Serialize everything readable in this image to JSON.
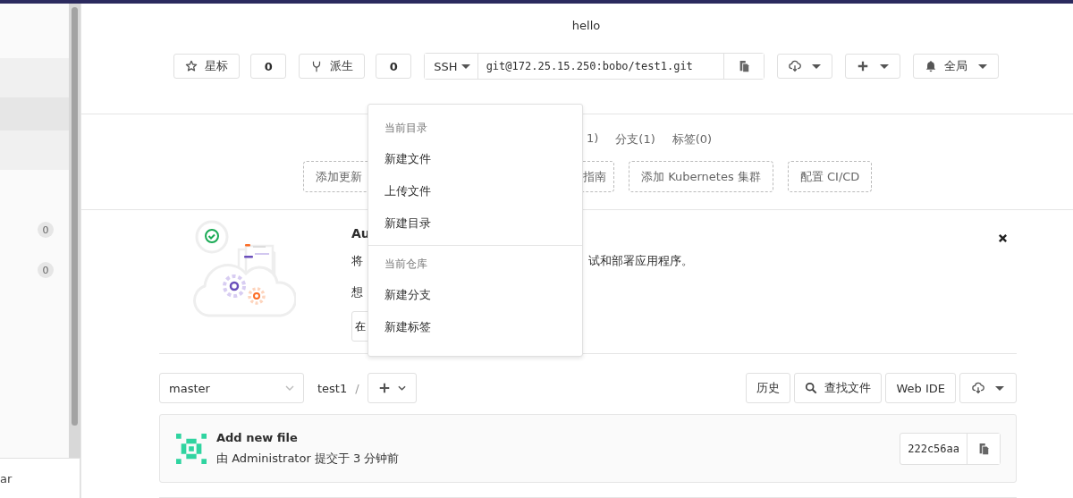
{
  "sidebar": {
    "items": [
      {
        "selected": false
      },
      {
        "selected": true
      },
      {
        "selected": false
      }
    ],
    "badges": [
      "0",
      "0"
    ],
    "footer": "ar"
  },
  "project_title": "hello",
  "actions": {
    "star": {
      "label": "星标",
      "count": "0"
    },
    "fork": {
      "label": "派生",
      "count": "0"
    },
    "clone": {
      "protocol": "SSH",
      "url": "git@172.25.15.250:bobo/test1.git"
    },
    "notification": {
      "label": "全局"
    }
  },
  "stats": [
    "1)",
    "分支(1)",
    "标签(0)"
  ],
  "quick_buttons": [
    "添加更新",
    "指南",
    "添加 Kubernetes 集群",
    "配置 CI/CD"
  ],
  "banner": {
    "title": "Au",
    "text_start": "将",
    "text_end": "试和部署应用程序。",
    "line2": "想",
    "button": "在"
  },
  "dropdown": {
    "sections": [
      {
        "header": "当前目录",
        "items": [
          "新建文件",
          "上传文件",
          "新建目录"
        ]
      },
      {
        "header": "当前仓库",
        "items": [
          "新建分支",
          "新建标签"
        ]
      }
    ]
  },
  "toolbar": {
    "branch": "master",
    "path": "test1",
    "separator": "/",
    "buttons": [
      "历史",
      "查找文件",
      "Web IDE"
    ]
  },
  "commit": {
    "title": "Add new file",
    "meta": "由 Administrator 提交于 3 分钟前",
    "sha": "222c56aa"
  }
}
